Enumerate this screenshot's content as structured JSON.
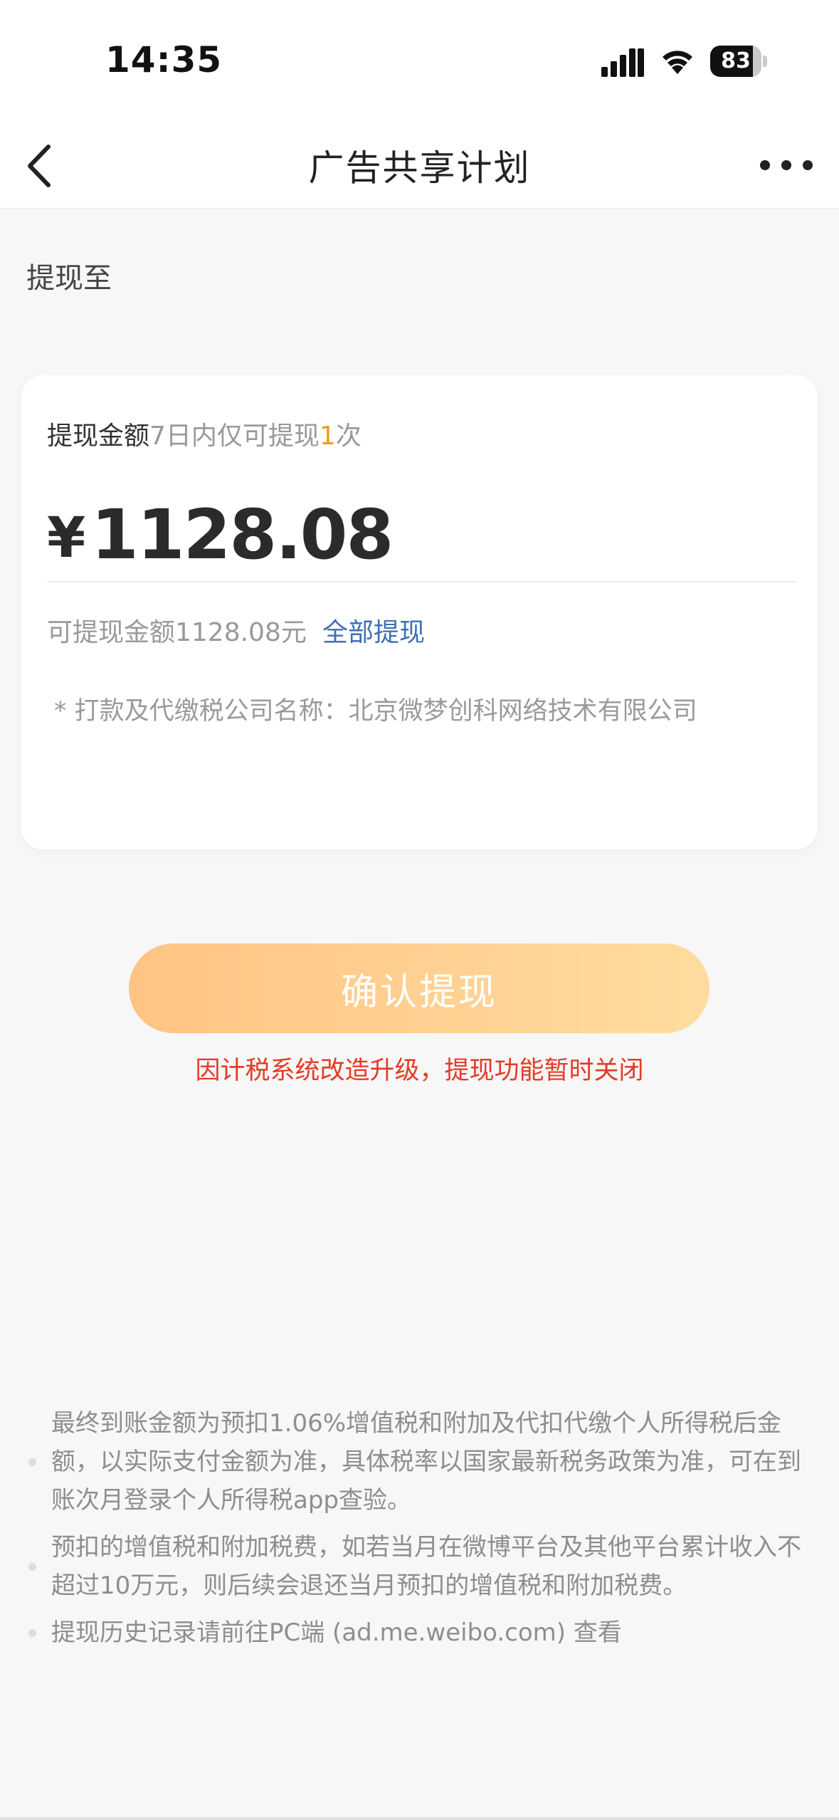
{
  "status_bar": {
    "time": "14:35",
    "battery_percent": 83,
    "battery_label": "83",
    "icons": [
      "signal-icon",
      "wifi-icon",
      "battery-icon"
    ]
  },
  "nav": {
    "title": "广告共享计划",
    "back_icon": "chevron-left-icon",
    "more_icon": "ellipsis-icon"
  },
  "section_label": "提现至",
  "withdraw_card": {
    "amount_label": "提现金额",
    "limit_prefix": "7日内仅可提现",
    "limit_count": "1",
    "limit_suffix": "次",
    "currency_symbol": "¥",
    "amount_value": "1128.08",
    "available_text": "可提现金额1128.08元",
    "withdraw_all_label": "全部提现",
    "company_note": "* 打款及代缴税公司名称：北京微梦创科网络技术有限公司"
  },
  "confirm_button_label": "确认提现",
  "error_message": "因计税系统改造升级，提现功能暂时关闭",
  "notes": [
    "最终到账金额为预扣1.06%增值税和附加及代扣代缴个人所得税后金额，以实际支付金额为准，具体税率以国家最新税务政策为准，可在到账次月登录个人所得税app查验。",
    "预扣的增值税和附加税费，如若当月在微博平台及其他平台累计收入不超过10万元，则后续会退还当月预扣的增值税和附加税费。",
    "提现历史记录请前往PC端 (ad.me.weibo.com) 查看"
  ],
  "colors": {
    "accent_orange": "#f29b1f",
    "link_blue": "#3e6fb5",
    "error_red": "#e53a25",
    "button_gradient_start": "#ffc483",
    "button_gradient_end": "#ffdc9e"
  }
}
